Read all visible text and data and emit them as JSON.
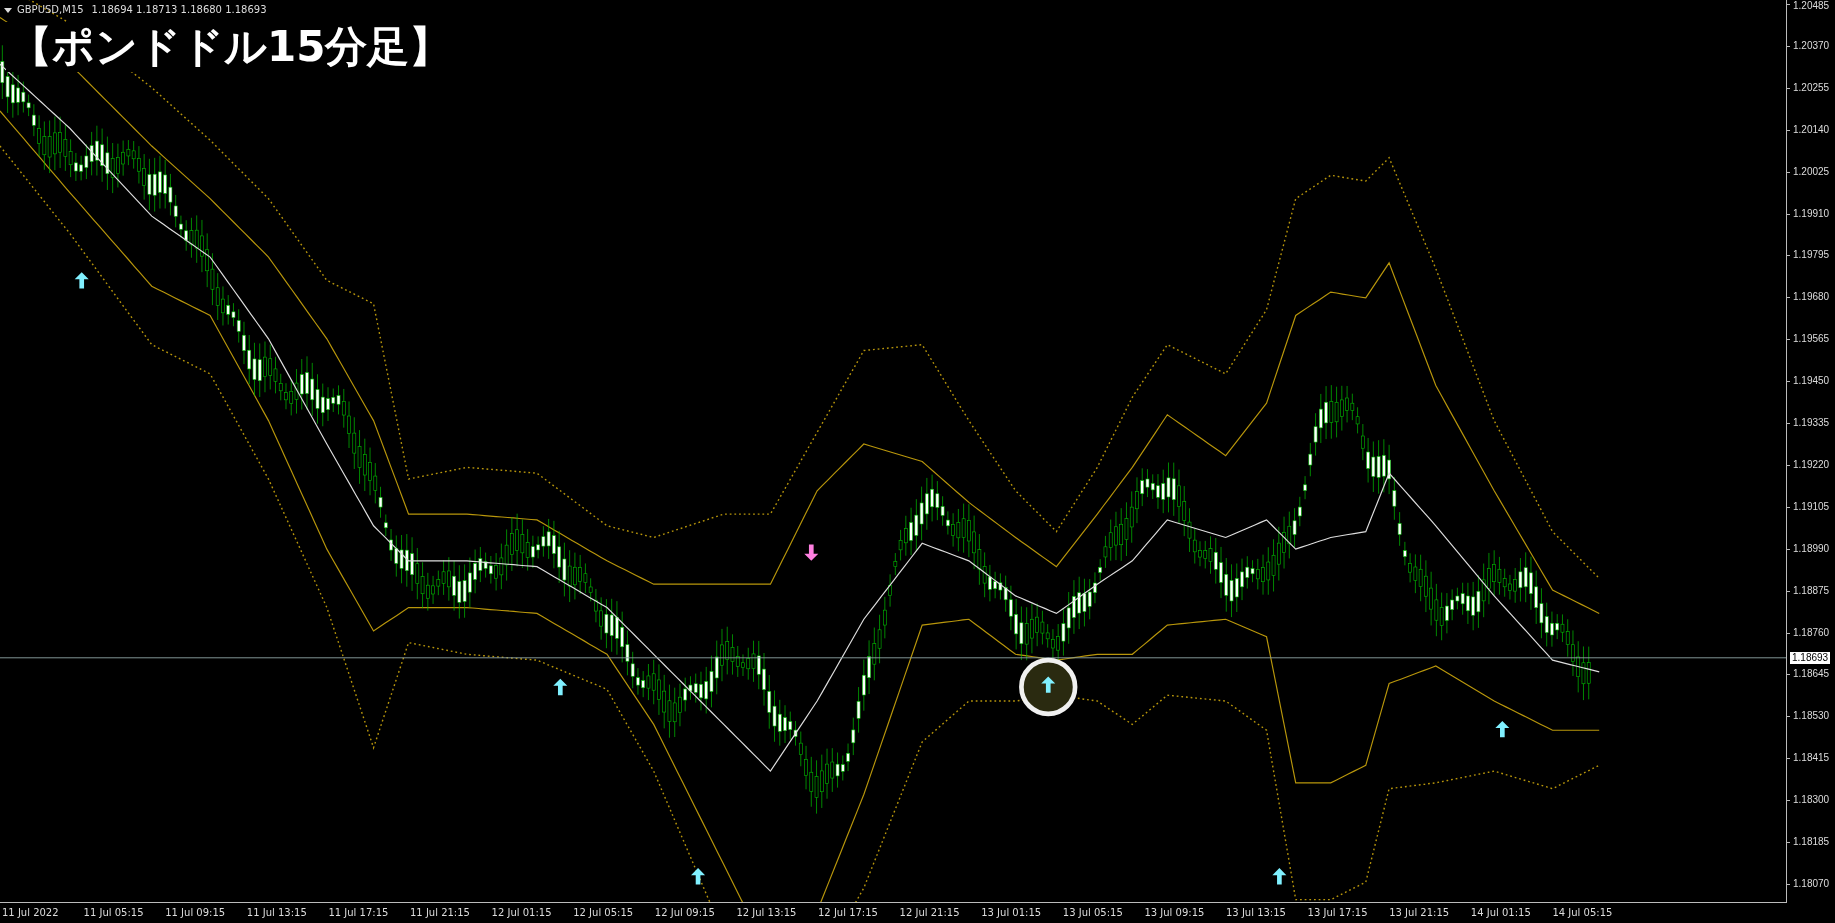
{
  "chart_header": {
    "symbol": "GBPUSD,M15",
    "quotes": "1.18694 1.18713 1.18680 1.18693"
  },
  "overlay_title": "【ポンドドル15分足】",
  "price_axis": [
    "1.20485",
    "1.20370",
    "1.20255",
    "1.20140",
    "1.20025",
    "1.19910",
    "1.19795",
    "1.19680",
    "1.19565",
    "1.19450",
    "1.19335",
    "1.19220",
    "1.19105",
    "1.18990",
    "1.18875",
    "1.18760",
    "1.18645",
    "1.18530",
    "1.18415",
    "1.18300",
    "1.18185",
    "1.18070"
  ],
  "current_price": "1.18693",
  "time_axis": [
    "11 Jul 2022",
    "11 Jul 05:15",
    "11 Jul 09:15",
    "11 Jul 13:15",
    "11 Jul 17:15",
    "11 Jul 21:15",
    "12 Jul 01:15",
    "12 Jul 05:15",
    "12 Jul 09:15",
    "12 Jul 13:15",
    "12 Jul 17:15",
    "12 Jul 21:15",
    "13 Jul 01:15",
    "13 Jul 05:15",
    "13 Jul 09:15",
    "13 Jul 13:15",
    "13 Jul 17:15",
    "13 Jul 21:15",
    "14 Jul 01:15",
    "14 Jul 05:15"
  ]
}
